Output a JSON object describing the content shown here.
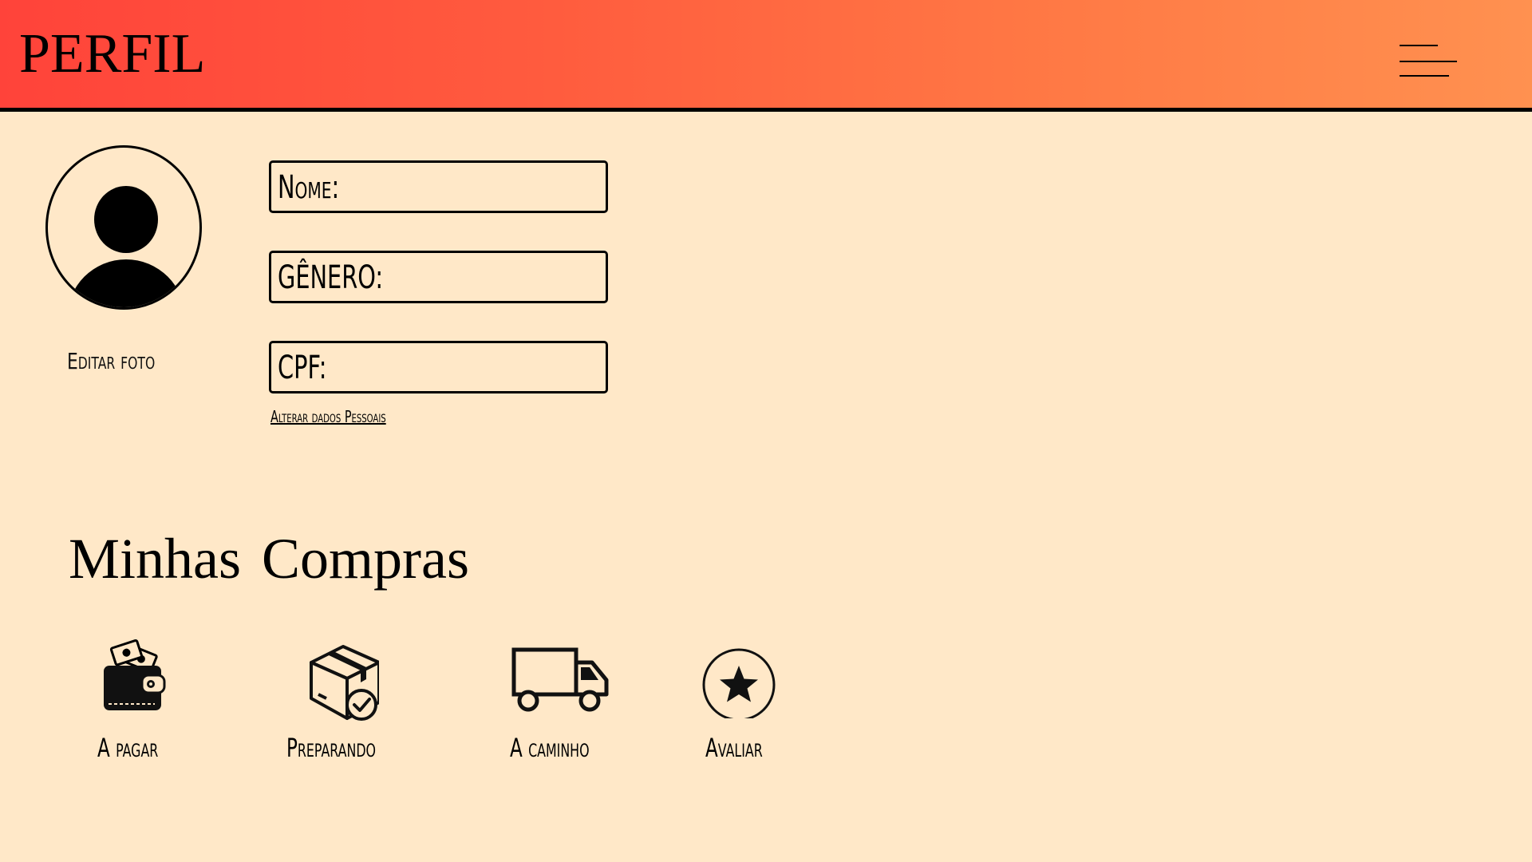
{
  "header": {
    "title": "PERFIL",
    "menu_icon": "hamburger-menu-icon"
  },
  "profile": {
    "avatar_icon": "user-avatar-icon",
    "edit_photo_label": "Editar foto",
    "fields": {
      "nome_label": "Nome:",
      "genero_label": "GÊNERO:",
      "cpf_label": "CPF:"
    },
    "change_data_link": "Alterar dados Pessoais"
  },
  "purchases": {
    "title": "Minhas Compras",
    "items": [
      {
        "label": "A pagar",
        "icon": "wallet-icon"
      },
      {
        "label": "Preparando",
        "icon": "package-check-icon"
      },
      {
        "label": "A caminho",
        "icon": "delivery-truck-icon"
      },
      {
        "label": "Avaliar",
        "icon": "star-circle-icon"
      }
    ]
  },
  "colors": {
    "header_gradient_start": "#FF433A",
    "header_gradient_end": "#FF9150",
    "background": "#FFE8C8"
  }
}
